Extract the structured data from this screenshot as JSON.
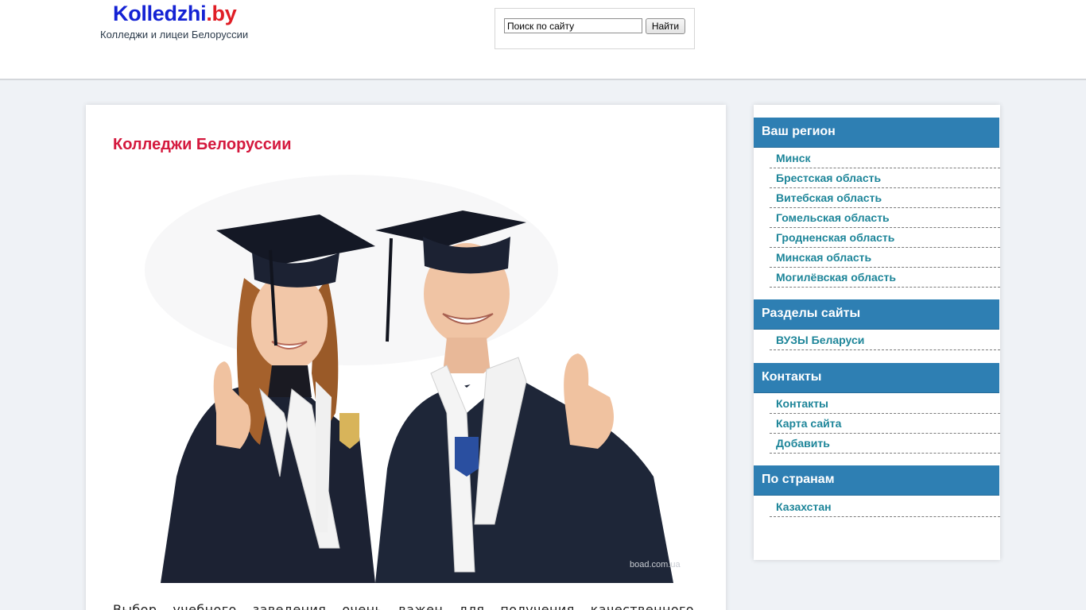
{
  "header": {
    "logo_name": "Kolledzhi",
    "logo_tld": ".by",
    "tagline": "Колледжи и лицеи Белоруссии",
    "search": {
      "value": "Поиск по сайту",
      "button_label": "Найти"
    }
  },
  "main": {
    "title": "Колледжи Белоруссии",
    "intro": "Выбор учебного заведения очень важен для получения качественного образования"
  },
  "sidebar": {
    "widgets": [
      {
        "title": "Ваш регион",
        "items": [
          "Минск",
          "Брестская область",
          "Витебская область",
          "Гомельская область",
          "Гродненская область",
          "Минская область",
          "Могилёвская область"
        ]
      },
      {
        "title": "Разделы сайты",
        "items": [
          "ВУЗЫ Беларуси"
        ]
      },
      {
        "title": "Контакты",
        "items": [
          "Контакты",
          "Карта сайта",
          "Добавить"
        ]
      },
      {
        "title": "По странам",
        "items": [
          "Казахстан"
        ]
      }
    ]
  },
  "colors": {
    "accent": "#2e7fb3",
    "title_red": "#d4183d",
    "link": "#1d8599",
    "logo_blue": "#1422d4",
    "logo_red": "#e01e26"
  }
}
